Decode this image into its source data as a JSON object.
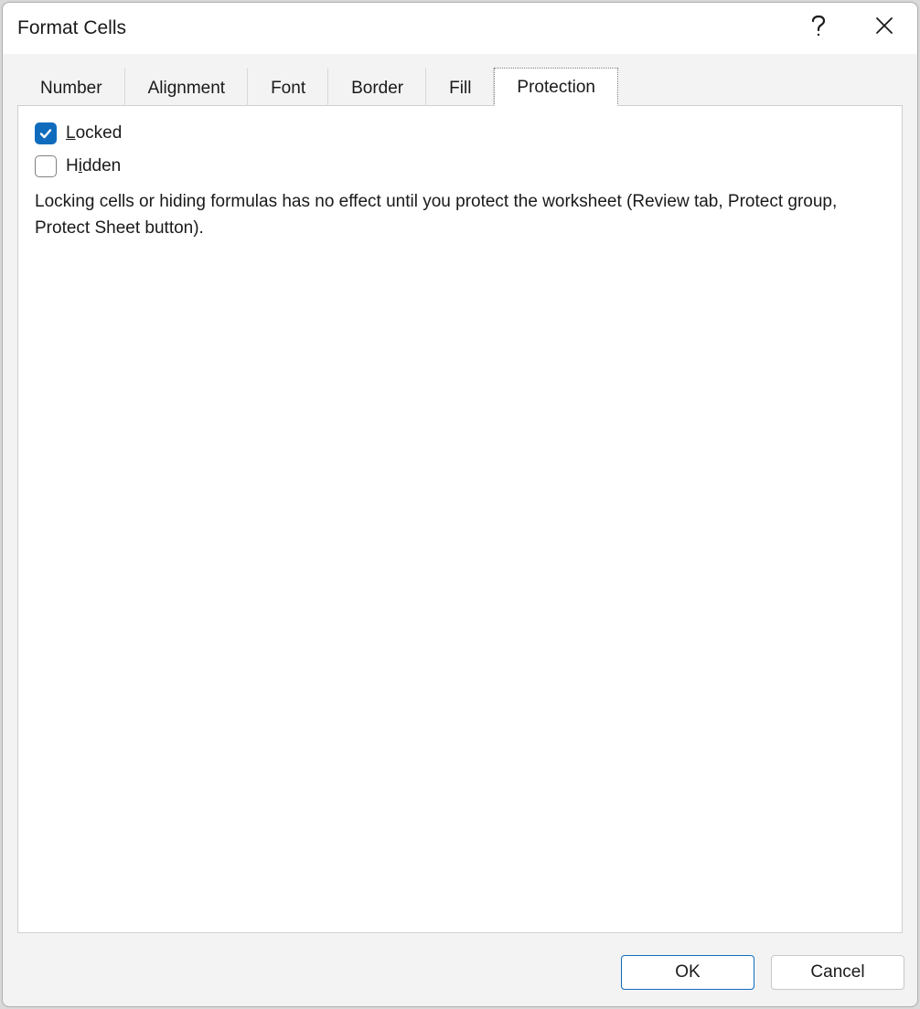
{
  "dialog": {
    "title": "Format Cells"
  },
  "tabs": {
    "number": "Number",
    "alignment": "Alignment",
    "font": "Font",
    "border": "Border",
    "fill": "Fill",
    "protection": "Protection",
    "active": "protection"
  },
  "protection": {
    "locked": {
      "prefix": "L",
      "rest": "ocked",
      "checked": true
    },
    "hidden": {
      "prefix": "H",
      "mid": "i",
      "rest": "dden",
      "checked": false
    },
    "description": "Locking cells or hiding formulas has no effect until you protect the worksheet (Review tab, Protect group, Protect Sheet button)."
  },
  "footer": {
    "ok": "OK",
    "cancel": "Cancel"
  }
}
